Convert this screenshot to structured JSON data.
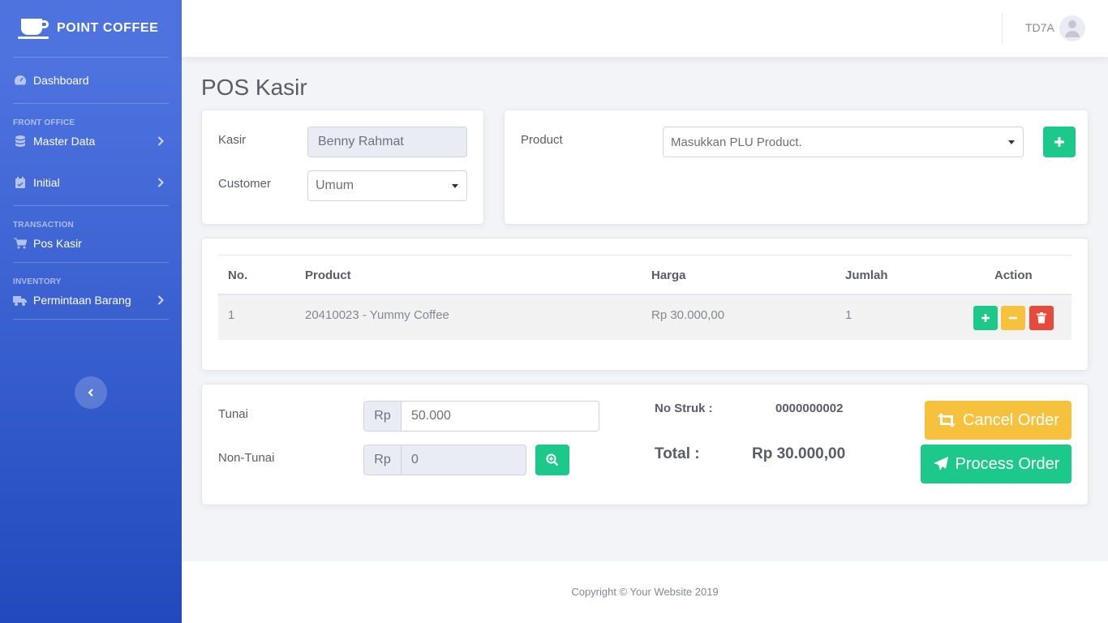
{
  "brand": {
    "name": "POINT COFFEE",
    "icon": "coffee-cup-icon"
  },
  "sidebar": {
    "dashboard": "Dashboard",
    "headings": {
      "front_office": "FRONT OFFICE",
      "transaction": "TRANSACTION",
      "inventory": "INVENTORY"
    },
    "items": {
      "master_data": "Master Data",
      "initial": "Initial",
      "pos_kasir": "Pos Kasir",
      "permintaan_barang": "Permintaan Barang"
    }
  },
  "topbar": {
    "username": "TD7A"
  },
  "page": {
    "title": "POS Kasir"
  },
  "order_info": {
    "kasir_label": "Kasir",
    "kasir_value": "Benny Rahmat",
    "customer_label": "Customer",
    "customer_value": "Umum"
  },
  "product": {
    "label": "Product",
    "select_placeholder": "Masukkan PLU Product."
  },
  "table": {
    "headers": [
      "No.",
      "Product",
      "Harga",
      "Jumlah",
      "Action"
    ],
    "rows": [
      {
        "no": "1",
        "product": "20410023 - Yummy Coffee",
        "harga": "Rp 30.000,00",
        "jumlah": "1"
      }
    ]
  },
  "payment": {
    "tunai_label": "Tunai",
    "tunai_prefix": "Rp",
    "tunai_value": "50.000",
    "non_tunai_label": "Non-Tunai",
    "non_tunai_prefix": "Rp",
    "non_tunai_value": "0",
    "no_struk_label": "No Struk :",
    "no_struk_value": "0000000002",
    "total_label": "Total :",
    "total_value": "Rp 30.000,00",
    "cancel_label": "Cancel Order",
    "process_label": "Process Order"
  },
  "footer": {
    "copyright": "Copyright © Your Website 2019"
  },
  "colors": {
    "primary": "#4e73df",
    "success": "#1cc88a",
    "warning": "#f6c23e",
    "danger": "#e74a3b"
  }
}
